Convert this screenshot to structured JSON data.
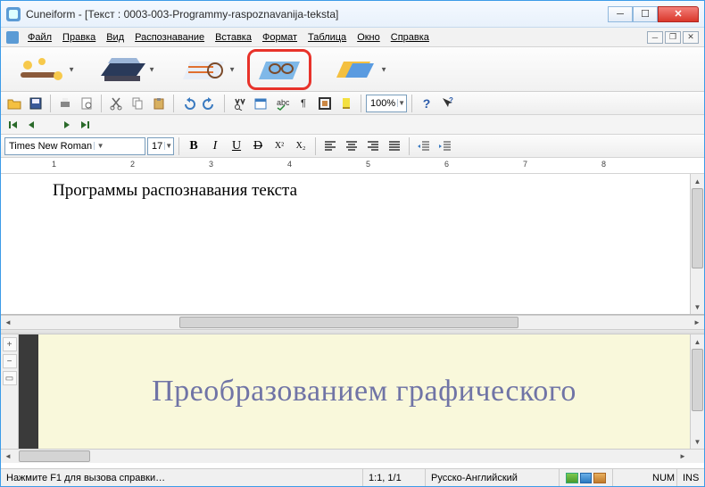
{
  "title": "Cuneiform - [Текст : 0003-003-Programmy-raspoznavanija-teksta]",
  "menu": {
    "file": "Файл",
    "edit": "Правка",
    "view": "Вид",
    "recognize": "Распознавание",
    "insert": "Вставка",
    "format": "Формат",
    "table": "Таблица",
    "window": "Окно",
    "help": "Справка"
  },
  "zoom_value": "100%",
  "font_name": "Times New Roman",
  "font_size": "17",
  "doc_text": "Программы распознавания текста",
  "img_text": "Преобразованием графического",
  "ruler_numbers": [
    "1",
    "2",
    "3",
    "4",
    "5",
    "6",
    "7",
    "8"
  ],
  "status": {
    "hint": "Нажмите F1 для вызова справки…",
    "pos": "1:1,  1/1",
    "lang": "Русско-Английский",
    "num": "NUM",
    "ins": "INS"
  }
}
